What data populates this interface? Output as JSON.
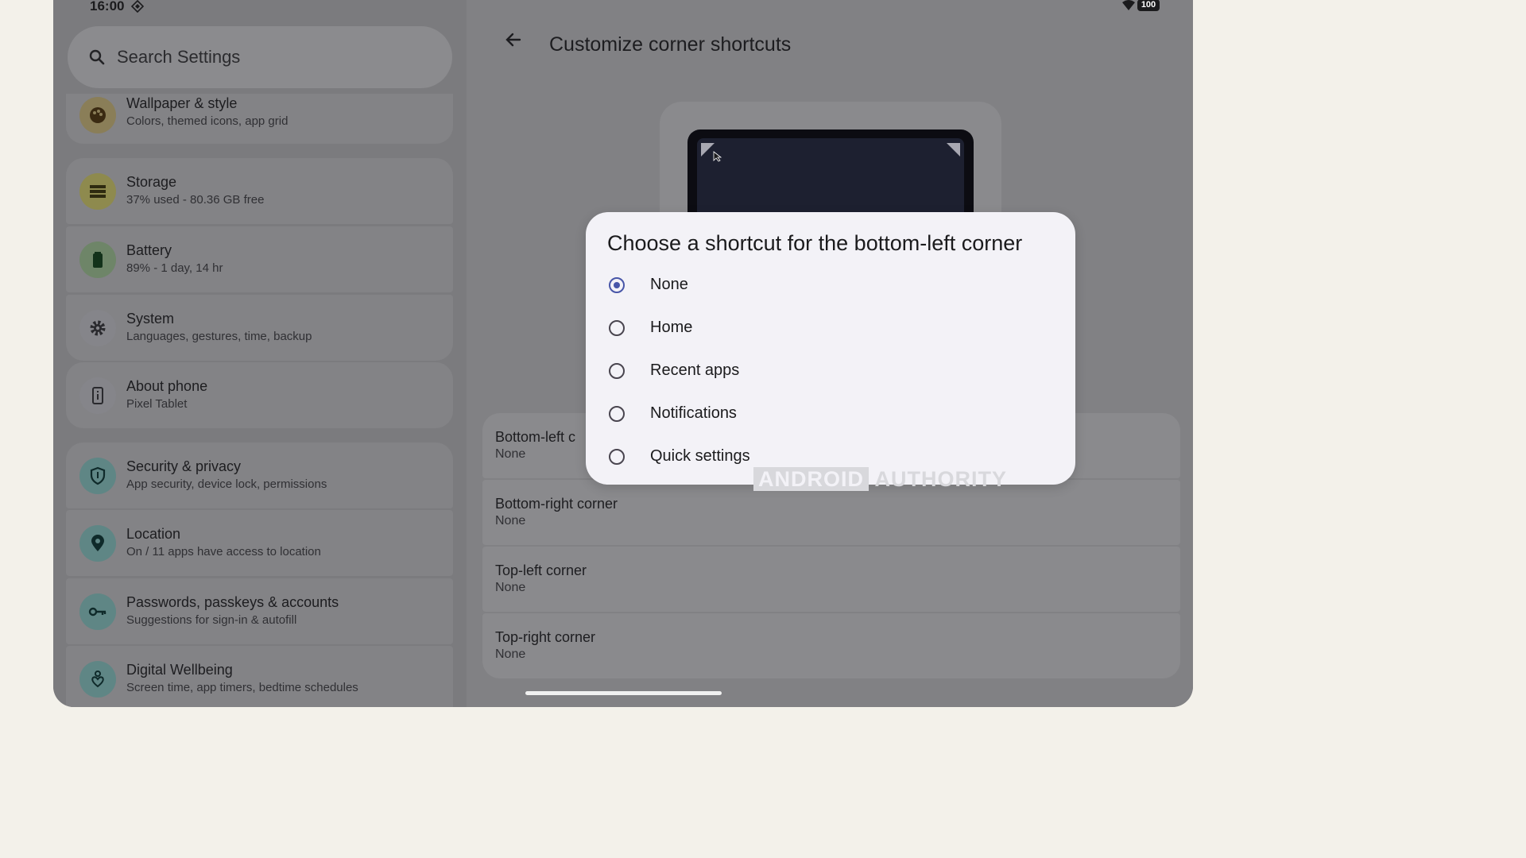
{
  "status": {
    "time": "16:00",
    "battery": "100"
  },
  "search": {
    "placeholder": "Search Settings"
  },
  "settings": [
    {
      "title": "Wallpaper & style",
      "subtitle": "Colors, themed icons, app grid",
      "icon": "palette-icon"
    },
    {
      "title": "Storage",
      "subtitle": "37% used - 80.36 GB free",
      "icon": "storage-icon"
    },
    {
      "title": "Battery",
      "subtitle": "89% - 1 day, 14 hr",
      "icon": "battery-icon"
    },
    {
      "title": "System",
      "subtitle": "Languages, gestures, time, backup",
      "icon": "gear-icon"
    },
    {
      "title": "About phone",
      "subtitle": "Pixel Tablet",
      "icon": "phone-info-icon"
    },
    {
      "title": "Security & privacy",
      "subtitle": "App security, device lock, permissions",
      "icon": "shield-icon"
    },
    {
      "title": "Location",
      "subtitle": "On / 11 apps have access to location",
      "icon": "location-pin-icon"
    },
    {
      "title": "Passwords, passkeys & accounts",
      "subtitle": "Suggestions for sign-in & autofill",
      "icon": "key-icon"
    },
    {
      "title": "Digital Wellbeing",
      "subtitle": "Screen time, app timers, bedtime schedules",
      "icon": "wellbeing-icon"
    }
  ],
  "page": {
    "title": "Customize corner shortcuts"
  },
  "corners": [
    {
      "title": "Bottom-left c",
      "value": "None"
    },
    {
      "title": "Bottom-right corner",
      "value": "None"
    },
    {
      "title": "Top-left corner",
      "value": "None"
    },
    {
      "title": "Top-right corner",
      "value": "None"
    }
  ],
  "dialog": {
    "title": "Choose a shortcut for the bottom-left corner",
    "options": [
      {
        "label": "None",
        "selected": true
      },
      {
        "label": "Home",
        "selected": false
      },
      {
        "label": "Recent apps",
        "selected": false
      },
      {
        "label": "Notifications",
        "selected": false
      },
      {
        "label": "Quick settings",
        "selected": false
      }
    ]
  },
  "watermark": {
    "part1": "ANDROID",
    "part2": "AUTHORITY"
  },
  "colors": {
    "accent": "#4856a8",
    "icon_bg_wallpaper": "#8a7e58",
    "icon_bg_storage": "#8e8a4e",
    "icon_bg_battery": "#6e8568",
    "icon_bg_system": "#85858a",
    "icon_bg_security": "#5f8685",
    "icon_bg_location": "#5f8685",
    "icon_bg_passwords": "#5f8685",
    "icon_bg_wellbeing": "#5f8685"
  }
}
